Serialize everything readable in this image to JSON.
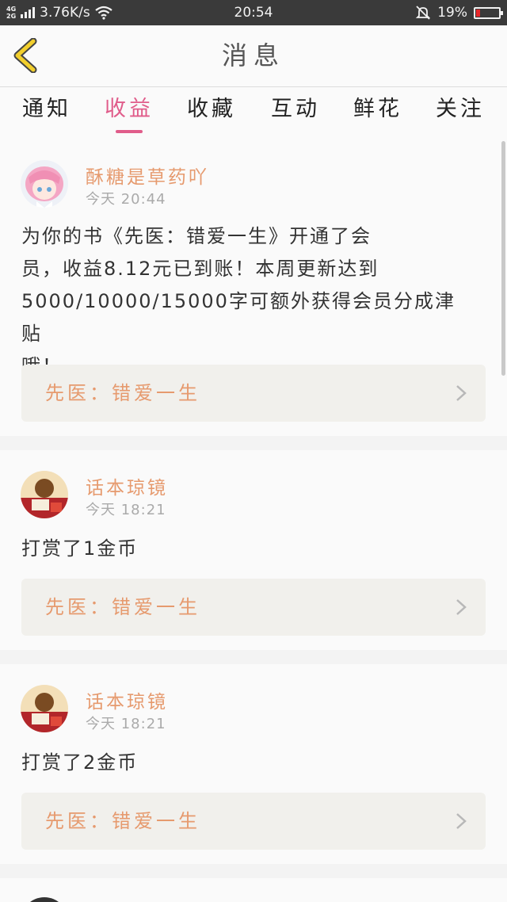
{
  "status_bar": {
    "net_top": "4G",
    "net_bottom": "2G",
    "speed": "3.76K/s",
    "time": "20:54",
    "battery": "19%",
    "battery_level": 0.19
  },
  "header": {
    "title": "消息",
    "back_icon": "chevron-left-icon"
  },
  "tabs": [
    {
      "label": "通知"
    },
    {
      "label": "收益",
      "active": true
    },
    {
      "label": "收藏"
    },
    {
      "label": "互动"
    },
    {
      "label": "鲜花"
    },
    {
      "label": "关注"
    }
  ],
  "messages": [
    {
      "user": "酥糖是草药吖",
      "time": "今天 20:44",
      "lines": [
        "为你的书《先医：错爱一生》开通了会",
        "员，收益8.12元已到账！本周更新达到",
        "5000/10000/15000字可额外获得会员分成津贴",
        "哦！"
      ],
      "book": "先医：错爱一生"
    },
    {
      "user": "话本琼镜",
      "time": "今天 18:21",
      "lines": [
        "打赏了1金币"
      ],
      "book": "先医：错爱一生"
    },
    {
      "user": "话本琼镜",
      "time": "今天 18:21",
      "lines": [
        "打赏了2金币"
      ],
      "book": "先医：错爱一生"
    }
  ],
  "colors": {
    "accent": "#e05c8a",
    "username": "#e69a6e",
    "back_arrow": "#f2cf2d"
  }
}
